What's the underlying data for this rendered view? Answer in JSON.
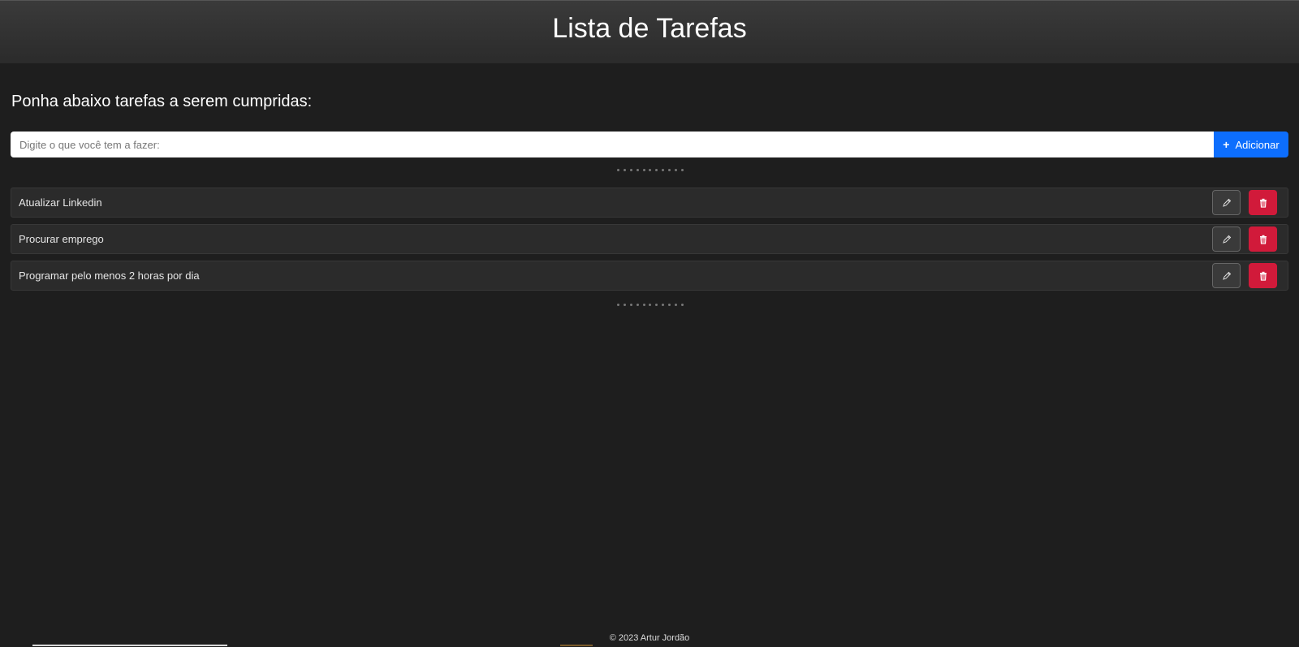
{
  "header": {
    "title": "Lista de Tarefas"
  },
  "main": {
    "subtitle": "Ponha abaixo tarefas a serem cumpridas:",
    "input": {
      "placeholder": "Digite o que você tem a fazer:",
      "value": ""
    },
    "add_button": {
      "icon": "plus-icon",
      "icon_glyph": "+",
      "label": "Adicionar"
    },
    "tasks": [
      {
        "text": "Atualizar Linkedin"
      },
      {
        "text": "Procurar emprego"
      },
      {
        "text": "Programar pelo menos 2 horas por dia"
      }
    ],
    "task_actions": {
      "edit_icon": "pencil-icon",
      "delete_icon": "trash-icon"
    }
  },
  "footer": {
    "text": "© 2023 Artur Jordão"
  },
  "colors": {
    "background": "#1e1e1e",
    "header": "#333333",
    "accent": "#0d6efd",
    "danger": "#d11a3a"
  }
}
